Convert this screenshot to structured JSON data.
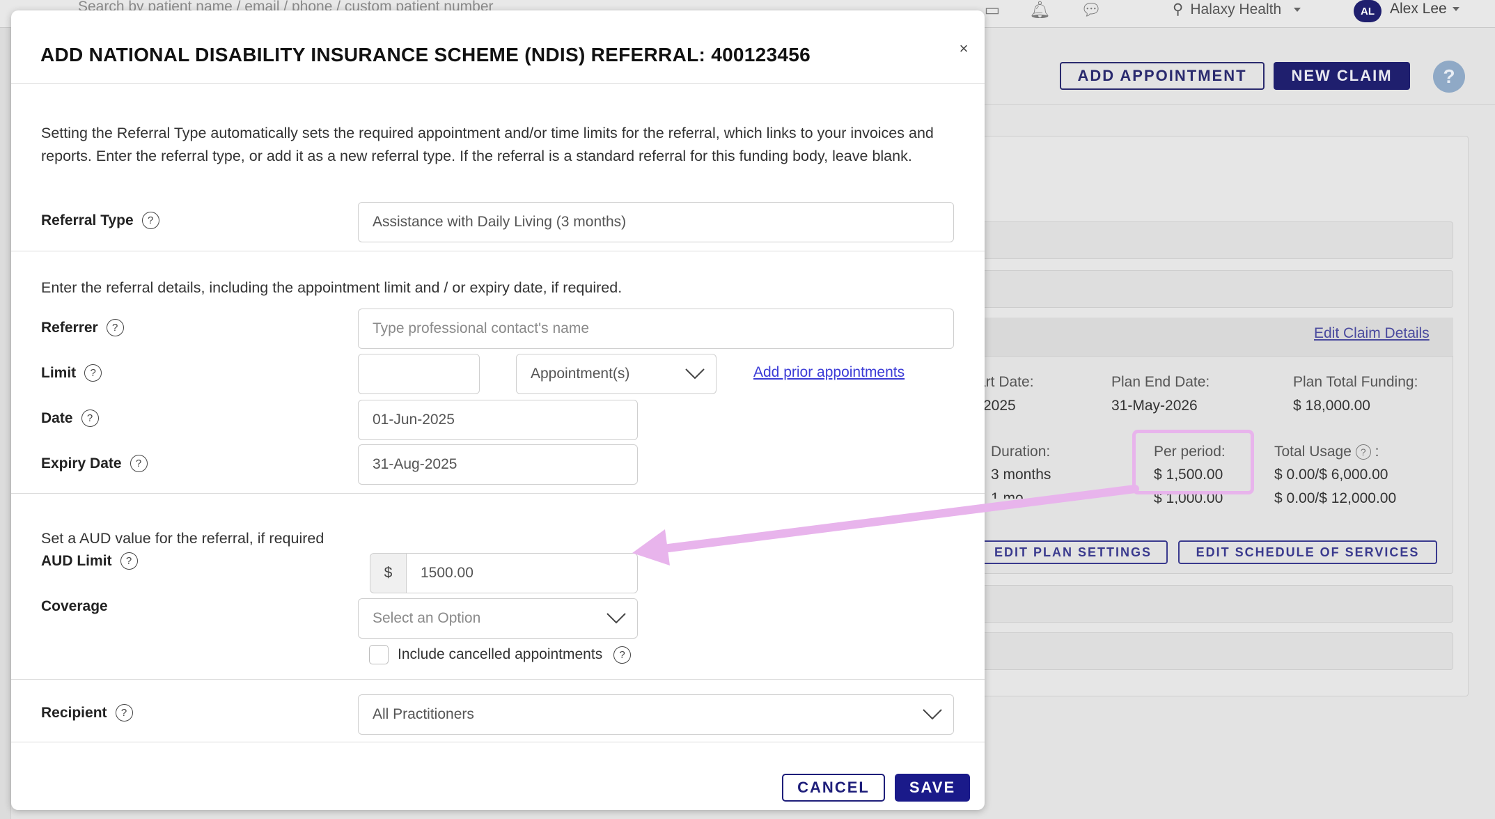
{
  "background": {
    "search_placeholder": "Search by patient name / email / phone / custom patient number",
    "location": "Halaxy Health",
    "user": {
      "initials": "AL",
      "name": "Alex Lee"
    },
    "add_appointment": "ADD APPOINTMENT",
    "new_claim": "NEW CLAIM",
    "help": "?",
    "edit_claim_details": "Edit Claim Details",
    "plan": {
      "start_date_label": "art Date:",
      "start_date_value": "2025",
      "end_date_label": "Plan End Date:",
      "end_date_value": "31-May-2026",
      "total_funding_label": "Plan Total Funding:",
      "total_funding_value": "$ 18,000.00",
      "duration_label": "Duration:",
      "duration_value": "3 months",
      "duration_value2": "1 mo",
      "per_period_label": "Per period:",
      "per_period_value": "$ 1,500.00",
      "per_period_value2": "$ 1,000.00",
      "total_usage_label": "Total Usage",
      "total_usage_value": "$ 0.00/$ 6,000.00",
      "total_usage_value2": "$ 0.00/$ 12,000.00"
    },
    "edit_plan_settings": "EDIT PLAN SETTINGS",
    "edit_schedule_of_services": "EDIT SCHEDULE OF SERVICES",
    "highlight_color": "#e8b4ec"
  },
  "modal": {
    "title": "ADD NATIONAL DISABILITY INSURANCE SCHEME (NDIS) REFERRAL: 400123456",
    "close": "×",
    "referral_type_desc": "Setting the Referral Type automatically sets the required appointment and/or time limits for the referral, which links to your invoices and reports. Enter the referral type, or add it as a new referral type. If the referral is a standard referral for this funding body, leave blank.",
    "referral_type_label": "Referral Type",
    "referral_type_value": "Assistance with Daily Living (3 months)",
    "details_desc": "Enter the referral details, including the appointment limit and / or expiry date, if required.",
    "referrer_label": "Referrer",
    "referrer_placeholder": "Type professional contact's name",
    "limit_label": "Limit",
    "limit_value": "",
    "limit_unit": "Appointment(s)",
    "add_prior_appointments": "Add prior appointments",
    "date_label": "Date",
    "date_value": "01-Jun-2025",
    "expiry_label": "Expiry Date",
    "expiry_value": "31-Aug-2025",
    "aud_desc": "Set a AUD value for the referral, if required",
    "aud_label": "AUD Limit",
    "aud_prefix": "$",
    "aud_value": "1500.00",
    "coverage_label": "Coverage",
    "coverage_placeholder": "Select an Option",
    "include_cancelled_label": "Include cancelled appointments",
    "include_cancelled_checked": false,
    "recipient_label": "Recipient",
    "recipient_value": "All Practitioners",
    "cancel": "CANCEL",
    "save": "SAVE"
  },
  "colors": {
    "primary": "#1a1a8a",
    "link": "#3b3bd6",
    "annotation": "#e8b4ec"
  }
}
